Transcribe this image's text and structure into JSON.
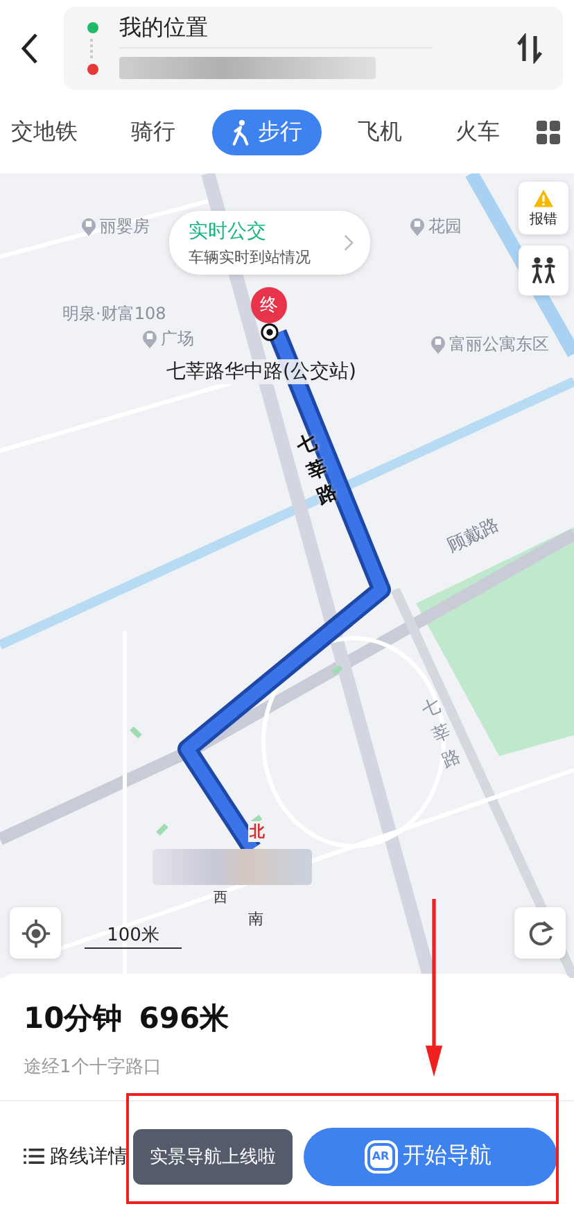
{
  "route_inputs": {
    "origin": "我的位置",
    "destination_blurred": true
  },
  "tabs": [
    {
      "label": "交地铁",
      "selected": false,
      "icon": false
    },
    {
      "label": "骑行",
      "selected": false,
      "icon": false
    },
    {
      "label": "步行",
      "selected": true,
      "icon": true
    },
    {
      "label": "飞机",
      "selected": false,
      "icon": false
    },
    {
      "label": "火车",
      "selected": false,
      "icon": false
    }
  ],
  "map": {
    "labels": [
      {
        "text": "丽婴房",
        "kind": "poi",
        "icon": true
      },
      {
        "text": "花园",
        "kind": "poi",
        "icon": true
      },
      {
        "text": "明泉·财富108",
        "kind": "poi",
        "icon": false
      },
      {
        "text": "广场",
        "kind": "poi",
        "icon": true
      },
      {
        "text": "富丽公寓东区",
        "kind": "poi",
        "icon": true
      },
      {
        "text": "七莘路华中路(公交站)",
        "kind": "stop",
        "icon": false
      },
      {
        "text": "七莘路",
        "kind": "road-vertical",
        "icon": false
      },
      {
        "text": "顾戴路",
        "kind": "road-slanted",
        "icon": false
      },
      {
        "text": "七莘路",
        "kind": "road-vertical-grey",
        "icon": false
      }
    ],
    "bubble": {
      "title": "实时公交",
      "subtitle": "车辆实时到站情况"
    },
    "end_pin": "终",
    "compass": {
      "north": "北",
      "west": "西",
      "south": "南"
    },
    "report": "报错",
    "scale": "100米"
  },
  "summary": {
    "duration": "10分钟",
    "distance": "696米",
    "via": "途经1个十字路口"
  },
  "footer": {
    "details": "路线详情",
    "tooltip": "实景导航上线啦",
    "start": "开始导航",
    "ar": "AR"
  }
}
